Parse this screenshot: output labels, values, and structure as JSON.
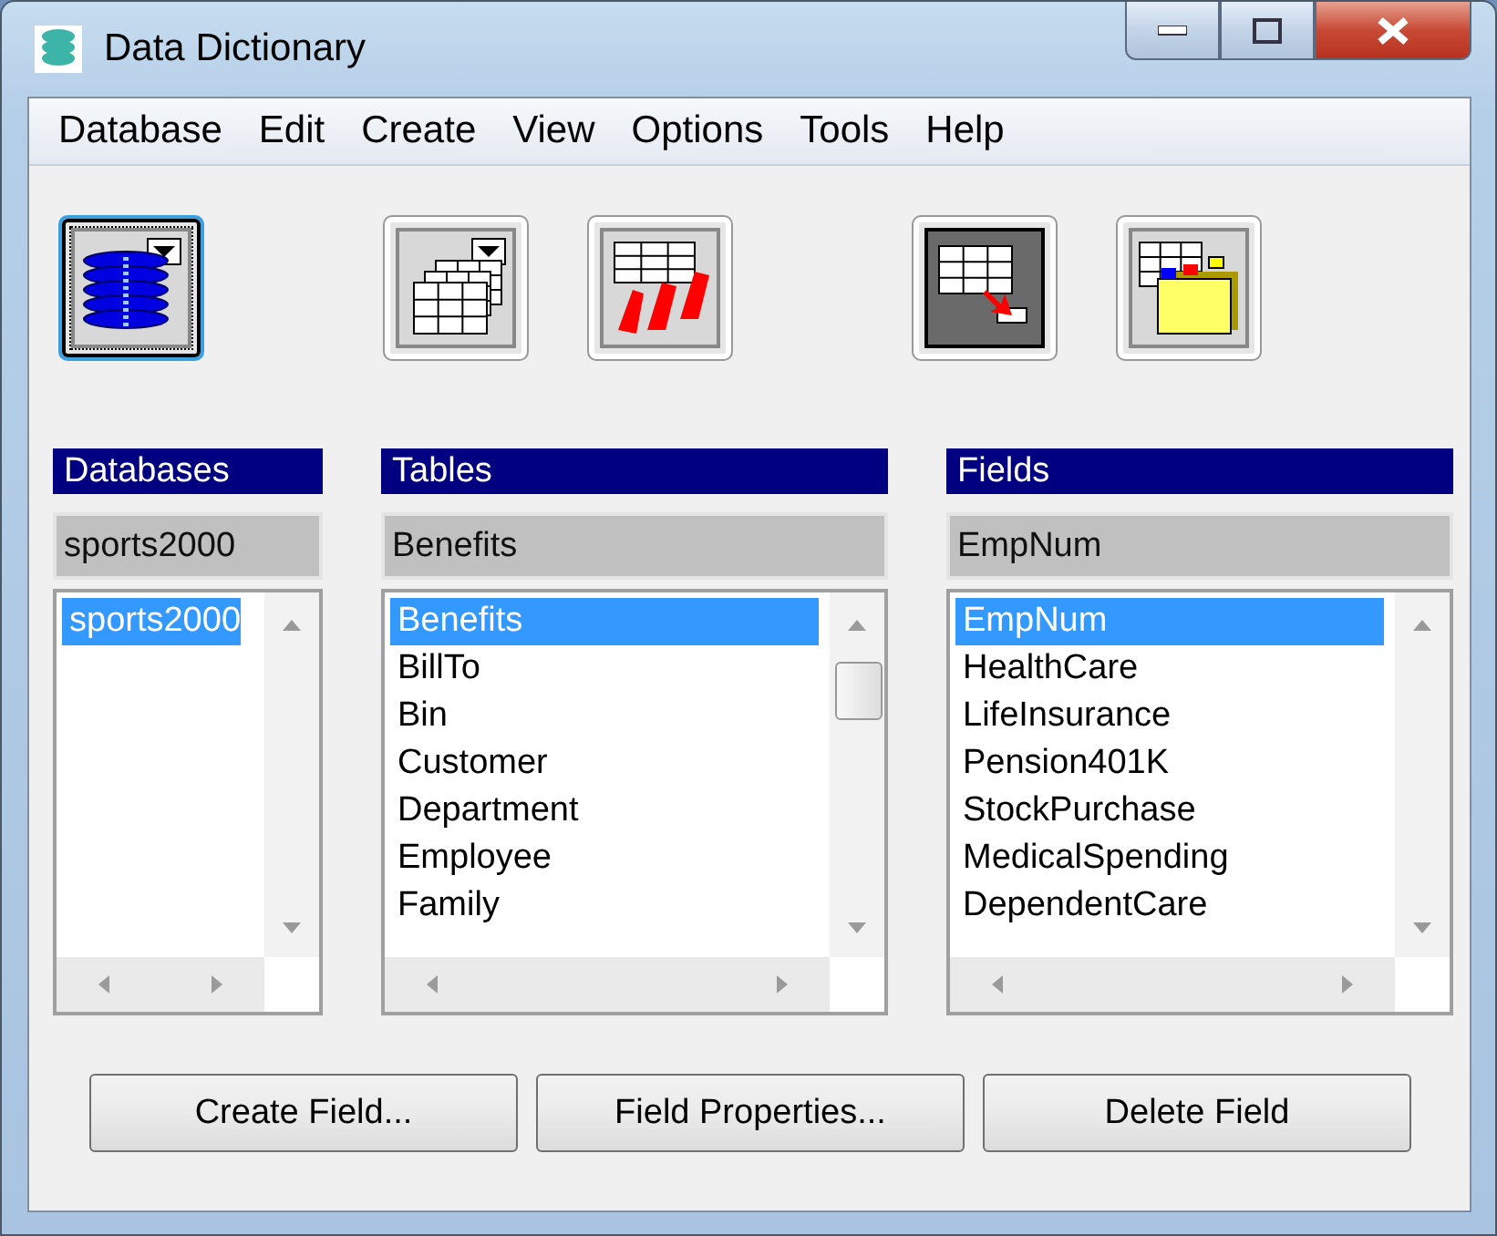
{
  "window": {
    "title": "Data Dictionary"
  },
  "menu": [
    {
      "label": "Database"
    },
    {
      "label": "Edit"
    },
    {
      "label": "Create"
    },
    {
      "label": "View"
    },
    {
      "label": "Options"
    },
    {
      "label": "Tools"
    },
    {
      "label": "Help"
    }
  ],
  "toolbar": [
    {
      "kind": "database",
      "selected": true,
      "pressed": false
    },
    {
      "kind": "gap"
    },
    {
      "kind": "tables",
      "selected": false,
      "pressed": false
    },
    {
      "kind": "sequences",
      "selected": false,
      "pressed": false
    },
    {
      "kind": "gap"
    },
    {
      "kind": "fields",
      "selected": false,
      "pressed": true
    },
    {
      "kind": "indexes",
      "selected": false,
      "pressed": false
    }
  ],
  "panels": [
    {
      "title": "Databases",
      "current": "sports2000",
      "items": [
        {
          "label": "sports2000",
          "selected": true
        }
      ],
      "thumb": false
    },
    {
      "title": "Tables",
      "current": "Benefits",
      "items": [
        {
          "label": "Benefits",
          "selected": true
        },
        {
          "label": "BillTo",
          "selected": false
        },
        {
          "label": "Bin",
          "selected": false
        },
        {
          "label": "Customer",
          "selected": false
        },
        {
          "label": "Department",
          "selected": false
        },
        {
          "label": "Employee",
          "selected": false
        },
        {
          "label": "Family",
          "selected": false
        }
      ],
      "thumb": true
    },
    {
      "title": "Fields",
      "current": "EmpNum",
      "items": [
        {
          "label": "EmpNum",
          "selected": true
        },
        {
          "label": "HealthCare",
          "selected": false
        },
        {
          "label": "LifeInsurance",
          "selected": false
        },
        {
          "label": "Pension401K",
          "selected": false
        },
        {
          "label": "StockPurchase",
          "selected": false
        },
        {
          "label": "MedicalSpending",
          "selected": false
        },
        {
          "label": "DependentCare",
          "selected": false
        }
      ],
      "thumb": false
    }
  ],
  "buttons": [
    {
      "label": "Create Field..."
    },
    {
      "label": "Field Properties..."
    },
    {
      "label": "Delete Field"
    }
  ]
}
